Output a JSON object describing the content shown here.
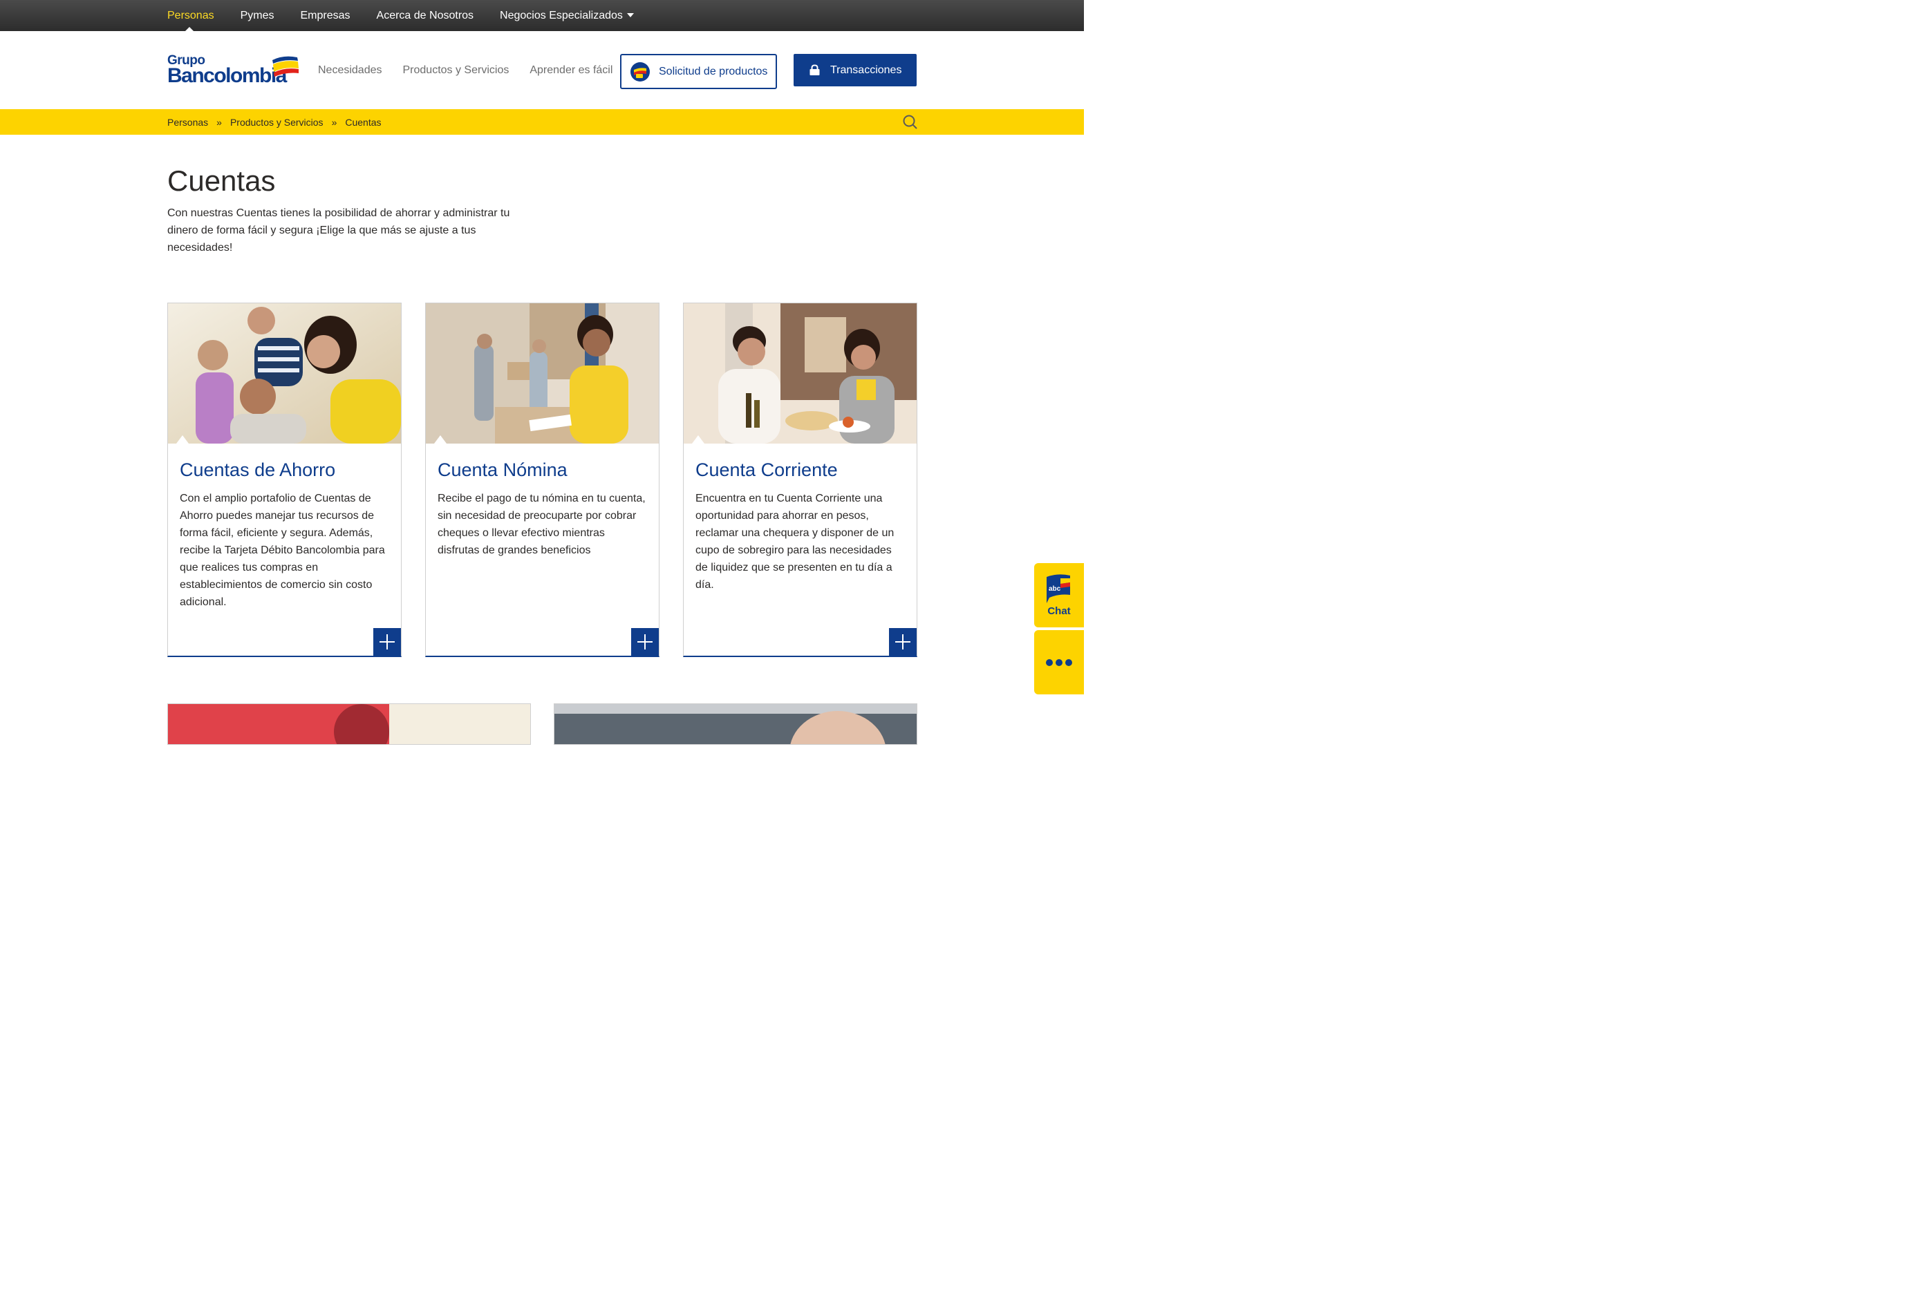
{
  "topbar": {
    "items": [
      {
        "label": "Personas",
        "active": true
      },
      {
        "label": "Pymes"
      },
      {
        "label": "Empresas"
      },
      {
        "label": "Acerca de Nosotros"
      },
      {
        "label": "Negocios Especializados"
      }
    ],
    "dropdown_icon": "caret-down-icon"
  },
  "header": {
    "logo_top": "Grupo",
    "logo_main": "Bancolombia",
    "nav": [
      "Necesidades",
      "Productos y Servicios",
      "Aprender es fácil"
    ],
    "solicitud_label": "Solicitud de productos",
    "transacciones_label": "Transacciones"
  },
  "breadcrumb": {
    "items": [
      "Personas",
      "Productos y Servicios",
      "Cuentas"
    ],
    "separator": "»"
  },
  "main": {
    "title": "Cuentas",
    "intro": "Con nuestras Cuentas tienes la posibilidad de ahorrar y administrar tu dinero de forma fácil y segura ¡Elige la que más se ajuste a tus necesidades!"
  },
  "cards": [
    {
      "title": "Cuentas de Ahorro",
      "desc": "Con el amplio portafolio de Cuentas de Ahorro puedes manejar tus recursos de forma fácil, eficiente y segura. Además, recibe la Tarjeta Débito Bancolombia para que realices tus compras en establecimientos de comercio sin costo adicional."
    },
    {
      "title": "Cuenta Nómina",
      "desc": "Recibe el pago de tu nómina en tu cuenta, sin necesidad de preocuparte por cobrar cheques o llevar efectivo mientras disfrutas de grandes beneficios"
    },
    {
      "title": "Cuenta Corriente",
      "desc": "Encuentra en tu Cuenta Corriente una oportunidad para ahorrar en pesos, reclamar una chequera y disponer de un cupo de sobregiro para las necesidades de liquidez que se presenten en tu día a día."
    }
  ],
  "side": {
    "chat_label": "Chat",
    "chat_badge": "abc"
  },
  "colors": {
    "brand_blue": "#0f3d8c",
    "brand_yellow": "#fdd300",
    "active_nav": "#fdda24"
  }
}
